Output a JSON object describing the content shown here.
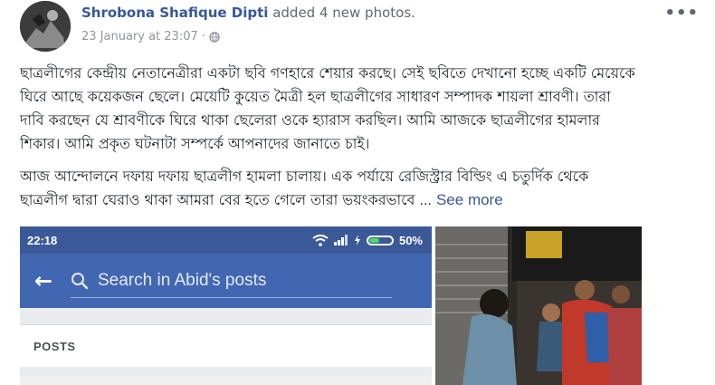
{
  "post": {
    "author": "Shrobona Shafique Dipti",
    "action": "added 4 new photos.",
    "timestamp": "23 January at 23:07",
    "separator": "·",
    "more_options": "•••",
    "paragraph1": "ছাত্রলীগের কেন্দ্রীয় নেতানেত্রীরা একটা ছবি গণহারে শেয়ার করছে। সেই ছবিতে দেখানো হচ্ছে একটি মেয়েকে ঘিরে আছে কয়েকজন ছেলে। মেয়েটি কুয়েত মৈত্রী হল ছাত্রলীগের সাধারণ সম্পাদক শায়লা শ্রাবণী। তারা দাবি করছেন যে শ্রাবণীকে ঘিরে থাকা ছেলেরা ওকে হ্যারাস করছিল। আমি আজকে ছাত্রলীগের হামলার শিকার। আমি প্রকৃত ঘটনাটা সম্পর্কে আপনাদের জানাতে চাই।",
    "paragraph2": "আজ আন্দোলনে দফায় দফায় ছাত্রলীগ হামলা চালায়। এক পর্যায়ে রেজিস্ট্রার বিল্ডিং এ চতুর্দিক থেকে ছাত্রলীগ দ্বারা ঘেরাও থাকা আমরা বের হতে গেলে তারা ভয়ংকরভাবে",
    "ellipsis": "...",
    "see_more": "See more"
  },
  "screenshot_photo": {
    "time": "22:18",
    "battery": "50%",
    "battery_level": 0.5,
    "back_icon": "back-arrow-icon",
    "search_placeholder": "Search in Abid's posts",
    "section_label": "POSTS"
  },
  "colors": {
    "link": "#365899",
    "fb_blue": "#4267b2",
    "status_blue": "#3b5998"
  }
}
